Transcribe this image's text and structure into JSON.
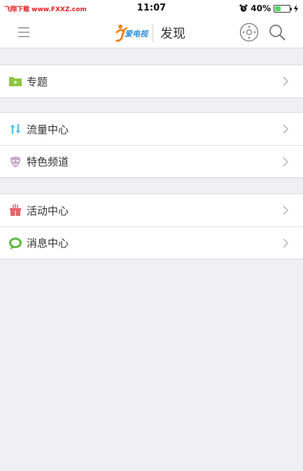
{
  "status_bar": {
    "watermark": "飞翔下载 www.FXXZ.com",
    "time": "11:07",
    "battery_percent": "40%",
    "battery_level": 0.4,
    "icons": [
      "alarm-icon",
      "battery-icon",
      "charging-icon"
    ]
  },
  "nav": {
    "title": "发现",
    "logo_text": "爱电视",
    "icons": [
      "menu-icon",
      "logo",
      "remote-control-icon",
      "search-icon"
    ]
  },
  "groups": [
    {
      "items": [
        {
          "label": "专题",
          "icon": "video-folder-icon",
          "icon_color": "#8cc63f"
        }
      ]
    },
    {
      "items": [
        {
          "label": "流量中心",
          "icon": "data-transfer-icon",
          "icon_color": "#4fc3e8"
        },
        {
          "label": "特色频道",
          "icon": "mask-icon",
          "icon_color": "#c9a9c9"
        }
      ]
    },
    {
      "items": [
        {
          "label": "活动中心",
          "icon": "gift-icon",
          "icon_color": "#e8636b"
        },
        {
          "label": "消息中心",
          "icon": "message-icon",
          "icon_color": "#5cb83a"
        }
      ]
    }
  ],
  "colors": {
    "background": "#efeff4",
    "row_background": "#ffffff",
    "text": "#333333",
    "chevron": "#bbbbbb",
    "brand_orange": "#f08519",
    "brand_blue": "#2a8fd8"
  }
}
